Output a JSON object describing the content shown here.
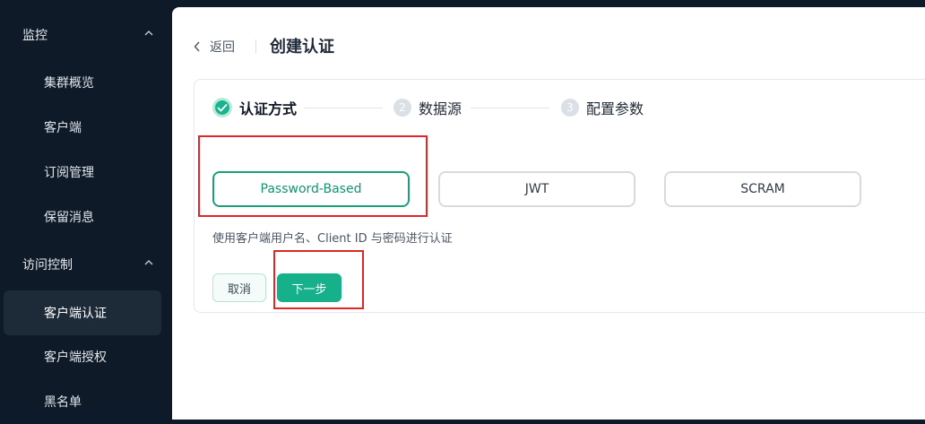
{
  "sidebar": {
    "groups": [
      {
        "label": "监控"
      },
      {
        "label": "访问控制"
      }
    ],
    "items": [
      {
        "label": "集群概览"
      },
      {
        "label": "客户端"
      },
      {
        "label": "订阅管理"
      },
      {
        "label": "保留消息"
      },
      {
        "label": "客户端认证"
      },
      {
        "label": "客户端授权"
      },
      {
        "label": "黑名单"
      }
    ]
  },
  "header": {
    "back_label": "返回",
    "title": "创建认证"
  },
  "steps": [
    {
      "label": "认证方式"
    },
    {
      "number": "2",
      "label": "数据源"
    },
    {
      "number": "3",
      "label": "配置参数"
    }
  ],
  "options": [
    {
      "label": "Password-Based"
    },
    {
      "label": "JWT"
    },
    {
      "label": "SCRAM"
    }
  ],
  "description": "使用客户端用户名、Client ID 与密码进行认证",
  "actions": {
    "cancel_label": "取消",
    "next_label": "下一步"
  },
  "colors": {
    "accent": "#16b08a",
    "highlight": "#e12626",
    "sidebar_bg": "#0e1a27"
  }
}
